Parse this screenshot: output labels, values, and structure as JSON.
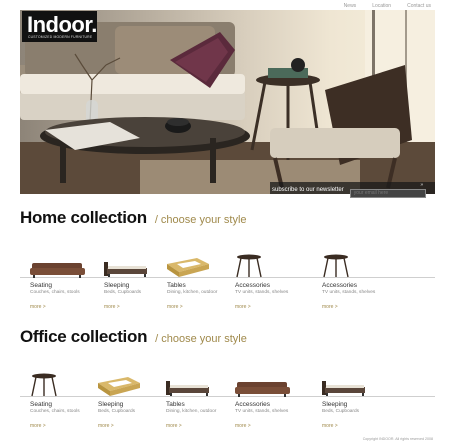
{
  "topnav": [
    "News",
    "Location",
    "Contact us"
  ],
  "logo": {
    "name": "Indoor.",
    "tagline": "CUSTOMIZED MODERN FURNITURE"
  },
  "newsletter": {
    "label": "subscribe to our newsletter",
    "placeholder": "your email here",
    "submit_glyph": "»"
  },
  "home": {
    "title": "Home collection",
    "subtitle": "/ choose your style",
    "items": [
      {
        "title": "Seating",
        "desc": "Couches, chairs, stools",
        "more": "more >",
        "icon": "sofa-icon"
      },
      {
        "title": "Sleeping",
        "desc": "Beds, Cupboards",
        "more": "more >",
        "icon": "bed-icon"
      },
      {
        "title": "Tables",
        "desc": "Dining, kitchen, outdoor",
        "more": "more >",
        "icon": "table-icon"
      },
      {
        "title": "Accessories",
        "desc": "TV units, stands, shelves",
        "more": "more >",
        "icon": "side-table-icon"
      },
      {
        "title": "Accessories",
        "desc": "TV units, stands, shelves",
        "more": "more >",
        "icon": "side-table-icon"
      }
    ]
  },
  "office": {
    "title": "Office collection",
    "subtitle": "/ choose your style",
    "items": [
      {
        "title": "Seating",
        "desc": "Couches, chairs, stools",
        "more": "more >",
        "icon": "side-table-icon"
      },
      {
        "title": "Sleeping",
        "desc": "Beds, Cupboards",
        "more": "more >",
        "icon": "table-icon"
      },
      {
        "title": "Tables",
        "desc": "Dining, kitchen, outdoor",
        "more": "more >",
        "icon": "bed-icon"
      },
      {
        "title": "Accessories",
        "desc": "TV units, stands, shelves",
        "more": "more >",
        "icon": "sofa-icon"
      },
      {
        "title": "Sleeping",
        "desc": "Beds, Cupboards",
        "more": "more >",
        "icon": "bed-icon"
      }
    ]
  },
  "footer": "Copyright INDOOR. All rights reserved 2008",
  "colors": {
    "accent": "#a08a4c",
    "title": "#111111",
    "logo_bg": "#111111"
  }
}
